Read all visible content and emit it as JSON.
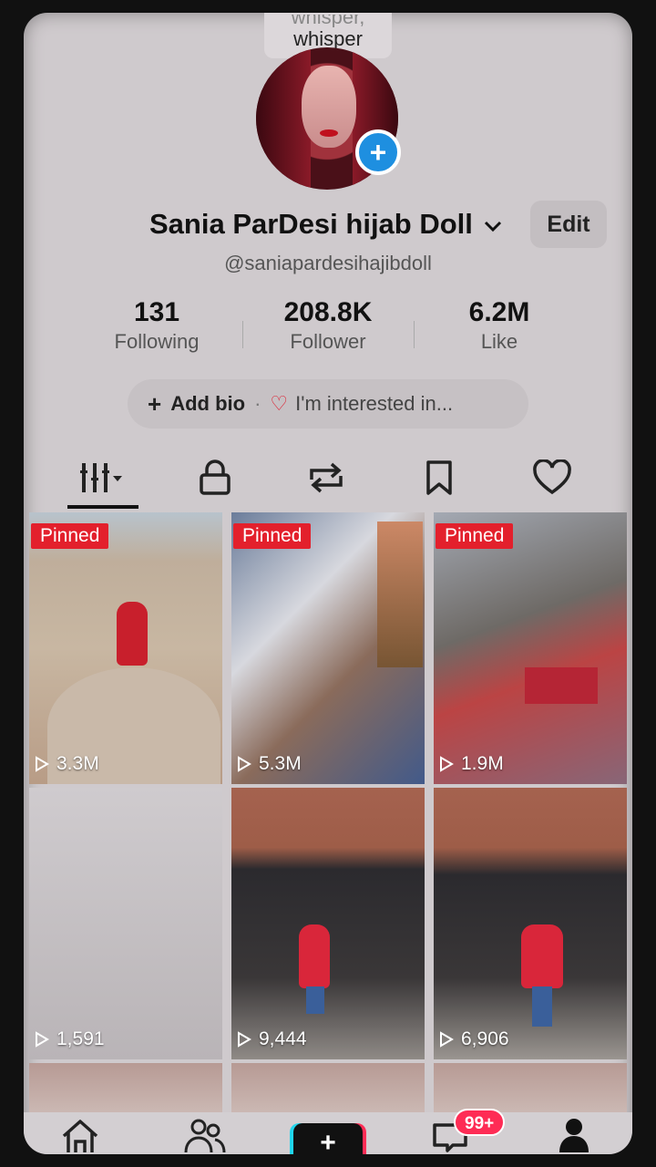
{
  "tooltip": {
    "line1": "whisper,",
    "line2": "whisper"
  },
  "profile": {
    "display_name": "Sania ParDesi hijab Doll",
    "username": "@saniapardesihajibdoll",
    "edit_label": "Edit"
  },
  "stats": [
    {
      "value": "131",
      "label": "Following"
    },
    {
      "value": "208.8K",
      "label": "Follower"
    },
    {
      "value": "6.2M",
      "label": "Like"
    }
  ],
  "bio": {
    "add_label": "Add bio",
    "separator": "·",
    "interest_label": "I'm interested in..."
  },
  "tabs": [
    {
      "icon": "grid-icon",
      "active": true
    },
    {
      "icon": "lock-icon"
    },
    {
      "icon": "repost-icon"
    },
    {
      "icon": "bookmark-icon"
    },
    {
      "icon": "heart-icon"
    }
  ],
  "videos": [
    {
      "pinned": "Pinned",
      "views": "3.3M"
    },
    {
      "pinned": "Pinned",
      "views": "5.3M"
    },
    {
      "pinned": "Pinned",
      "views": "1.9M"
    },
    {
      "views": "1,591"
    },
    {
      "views": "9,444"
    },
    {
      "views": "6,906"
    }
  ],
  "nav": {
    "items": [
      "home-icon",
      "friends-icon",
      "create-icon",
      "inbox-icon",
      "profile-icon"
    ],
    "inbox_badge": "99+"
  },
  "colors": {
    "pinned": "#e3202c",
    "badge": "#fe2c55",
    "add": "#1e8fe0"
  }
}
